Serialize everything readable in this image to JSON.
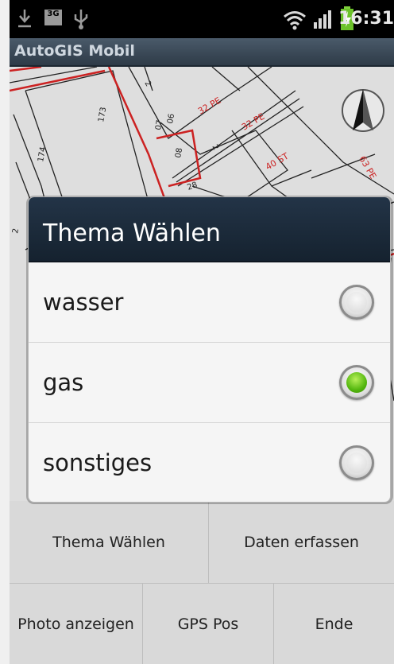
{
  "status_bar": {
    "time": "16:31",
    "network": "3G"
  },
  "app_title": "AutoGIS Mobil",
  "map": {
    "labels": [
      "2",
      "173",
      "07",
      "06",
      "08",
      "32 PE",
      "32 PE",
      "40 ST",
      "63 PE",
      "174",
      "2",
      "28",
      "2"
    ]
  },
  "dialog": {
    "title": "Thema Wählen",
    "options": [
      {
        "label": "wasser",
        "checked": false
      },
      {
        "label": "gas",
        "checked": true
      },
      {
        "label": "sonstiges",
        "checked": false
      }
    ]
  },
  "menu": {
    "thema_waehlen": "Thema Wählen",
    "daten_erfassen": "Daten erfassen",
    "photo_anzeigen": "Photo anzeigen",
    "gps_pos": "GPS Pos",
    "ende": "Ende"
  },
  "colors": {
    "accent_green": "#54b70f",
    "title_bar": "#2e3b48",
    "map_red": "#cc2222"
  }
}
